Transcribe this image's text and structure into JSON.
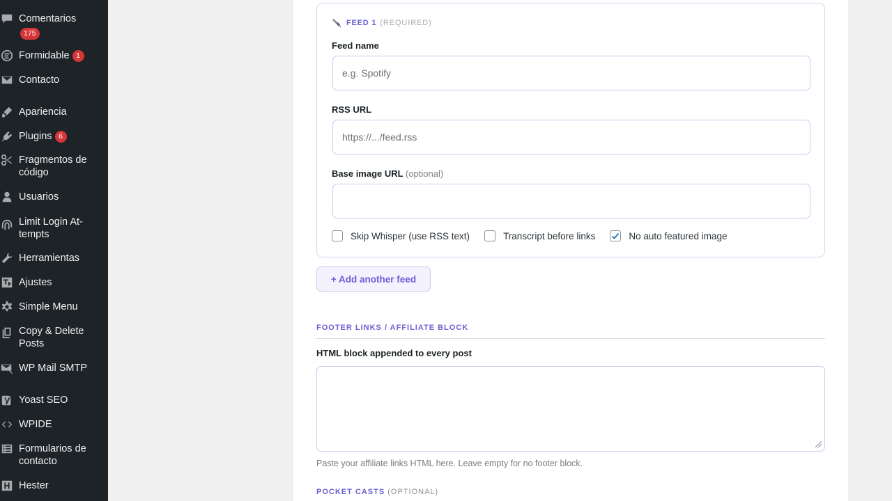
{
  "sidebar": {
    "items": [
      {
        "name": "comments",
        "label": "Comentarios",
        "badge": "175",
        "icon": "comment-icon"
      },
      {
        "name": "formidable",
        "label": "Formidable",
        "badge": "1",
        "icon": "formidable-icon"
      },
      {
        "name": "contact",
        "label": "Contacto",
        "icon": "envelope-icon"
      },
      {
        "name": "appearance",
        "label": "Apariencia",
        "icon": "paintbrush-icon"
      },
      {
        "name": "plugins",
        "label": "Plugins",
        "badge": "6",
        "icon": "plugin-icon"
      },
      {
        "name": "snippets",
        "label": "Fragmentos de código",
        "icon": "scissors-icon"
      },
      {
        "name": "users",
        "label": "Usuarios",
        "icon": "user-icon"
      },
      {
        "name": "limit-login",
        "label": "Limit Login At-tempts",
        "icon": "fingerprint-icon"
      },
      {
        "name": "tools",
        "label": "Herramientas",
        "icon": "wrench-icon"
      },
      {
        "name": "settings",
        "label": "Ajustes",
        "icon": "settings-icon"
      },
      {
        "name": "simple-menu",
        "label": "Simple Menu",
        "icon": "gear-icon"
      },
      {
        "name": "copy-delete",
        "label": "Copy & Delete Posts",
        "icon": "copy-icon"
      },
      {
        "name": "wp-mail-smtp",
        "label": "WP Mail SMTP",
        "icon": "mail-icon"
      },
      {
        "name": "yoast",
        "label": "Yoast SEO",
        "icon": "yoast-icon"
      },
      {
        "name": "wpide",
        "label": "WPIDE",
        "icon": "code-icon"
      },
      {
        "name": "contact-forms",
        "label": "Formularios de contacto",
        "icon": "list-icon"
      },
      {
        "name": "hester",
        "label": "Hester",
        "icon": "hester-icon"
      }
    ]
  },
  "feed": {
    "heading": "FEED 1",
    "required": "(REQUIRED)",
    "name_label": "Feed name",
    "name_placeholder": "e.g. Spotify",
    "rss_label": "RSS URL",
    "rss_placeholder": "https://.../feed.rss",
    "base_label": "Base image URL",
    "base_optional": "(optional)",
    "base_value": "",
    "checkboxes": [
      {
        "label": "Skip Whisper (use RSS text)",
        "checked": false
      },
      {
        "label": "Transcript before links",
        "checked": false
      },
      {
        "label": "No auto featured image",
        "checked": true
      }
    ]
  },
  "add_feed_label": "+ Add another feed",
  "footer": {
    "section_title": "FOOTER LINKS / AFFILIATE BLOCK",
    "textarea_label": "HTML block appended to every post",
    "textarea_value": "",
    "help": "Paste your affiliate links HTML here. Leave empty for no footer block."
  },
  "pocket_casts": {
    "section_title": "POCKET CASTS",
    "optional": "(OPTIONAL)"
  },
  "colors": {
    "sidebar_bg": "#1d2327",
    "accent": "#6b5fd3",
    "badge": "#d63638",
    "input_border": "#cfc8f0",
    "check": "#2271b1"
  }
}
